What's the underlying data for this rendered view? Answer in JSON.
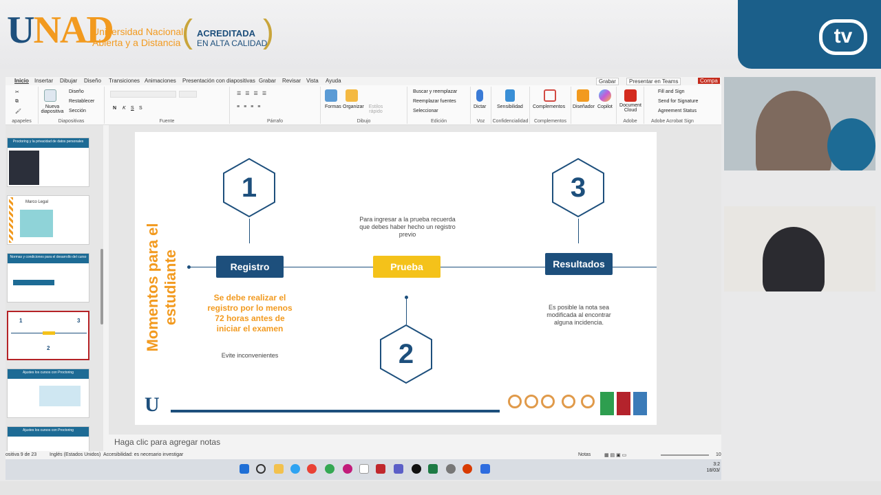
{
  "banner": {
    "university_short": "UNAD",
    "university_name_line1": "Universidad Nacional",
    "university_name_line2": "Abierta y a Distancia",
    "accreditation_line1": "ACREDITADA",
    "accreditation_line2": "EN ALTA CALIDAD",
    "tv_label": "tv"
  },
  "ribbon": {
    "tabs": [
      "Inicio",
      "Insertar",
      "Dibujar",
      "Diseño",
      "Transiciones",
      "Animaciones",
      "Presentación con diapositivas",
      "Grabar",
      "Revisar",
      "Vista",
      "Ayuda"
    ],
    "active_tab": "Inicio",
    "right_buttons": {
      "record": "Grabar",
      "present_teams": "Presentar en Teams",
      "share": "Compa"
    },
    "groups": {
      "clipboard": "apapeles",
      "slides": "Diapositivas",
      "font": "Fuente",
      "paragraph": "Párrafo",
      "drawing": "Dibujo",
      "editing": "Edición",
      "voice": "Voz",
      "sensitivity": "Confidencialidad",
      "addins": "Complementos",
      "adobe": "Adobe",
      "adobe_sign": "Adobe Acrobat Sign"
    },
    "buttons": {
      "new_slide": "Nueva diapositiva",
      "layout": "Diseño",
      "reset": "Restablecer",
      "section": "Sección",
      "shapes": "Formas",
      "arrange": "Organizar",
      "quick_styles": "Estilos rápido",
      "find_replace": "Buscar y reemplazar",
      "replace_fonts": "Reemplazar fuentes",
      "select": "Seleccionar",
      "dictate": "Dictar",
      "sensitivity": "Sensibilidad",
      "addins": "Complementos",
      "designer": "Diseñador",
      "copilot": "Copilot",
      "document_cloud": "Document Cloud",
      "fill_sign": "Fill and Sign",
      "send_signature": "Send for Signature",
      "agreement_status": "Agreement Status"
    }
  },
  "thumbnails": [
    {
      "title": "Proctoring y la privacidad de datos personales"
    },
    {
      "title": "Marco Legal"
    },
    {
      "title": "Normas y condiciones para el desarrollo del curso"
    },
    {
      "title": ""
    },
    {
      "title": "Ajustes los cursos con Proctoring"
    },
    {
      "title": "Ajustes los cursos con Proctoring"
    }
  ],
  "slide": {
    "title": "Momentos para el estudiante",
    "step1": {
      "number": "1",
      "label": "Registro",
      "highlight": "Se debe realizar el registro por lo menos 72 horas antes de iniciar el examen",
      "note": "Evite inconvenientes"
    },
    "step2": {
      "number": "2",
      "label": "Prueba",
      "note": "Para ingresar a la prueba recuerda que debes haber hecho un registro previo"
    },
    "step3": {
      "number": "3",
      "label": "Resultados",
      "note": "Es posible la nota sea modificada al encontrar alguna incidencia."
    }
  },
  "notes_placeholder": "Haga clic para agregar notas",
  "status": {
    "slide_counter": "ositiva 9 de 23",
    "language": "Inglés (Estados Unidos)",
    "accessibility": "Accesibilidad: es necesario investigar",
    "notes": "Notas",
    "zoom": "10"
  },
  "taskbar": {
    "time": "3:2",
    "date": "18/03/"
  },
  "colors": {
    "brand_blue": "#1d4f7c",
    "brand_orange": "#f29a1f",
    "yellow": "#f4c21a"
  }
}
